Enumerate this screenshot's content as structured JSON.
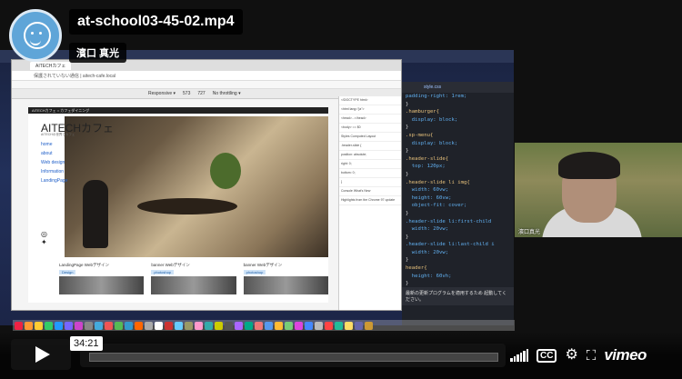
{
  "overlay": {
    "video_title": "at-school03-45-02.mp4",
    "byline": "濱口 真光"
  },
  "screen": {
    "browser": {
      "tab_title": "AITECHカフェ",
      "address": "保護されていない通信 | aitech-cafe.local",
      "devbar_device": "Responsive ▾",
      "devbar_w": "573",
      "devbar_h": "727",
      "devbar_throttle": "No throttling ▾",
      "site": {
        "topbar": "AITECHカフェ  ○  カフェダイニング",
        "brand": "AITECHカフェ",
        "brand_sub": "AITECHの世界でカフェ",
        "nav": [
          "home",
          "about",
          "Web design",
          "Information",
          "LandingPage"
        ],
        "works": [
          {
            "title": "LandingPage Webデザイン",
            "tag": "Design"
          },
          {
            "title": "banner Webデザイン",
            "tag": "photoshop"
          },
          {
            "title": "banner Webデザイン",
            "tag": "photoshop"
          }
        ]
      },
      "devtools_lines": [
        "<!DOCTYPE html>",
        "<html lang=\"ja\">",
        "<head>...</head>",
        "<body> == $0",
        "Styles  Computed  Layout",
        ".header-slide {",
        "position: absolute;",
        "right: 0;",
        "bottom: 0;",
        "}",
        "Console  What's New",
        "Highlights from the Chrome 97 update"
      ]
    },
    "editor": {
      "tab": "style.css",
      "lines": [
        {
          "n": "",
          "t": "padding-right: 1rem;"
        },
        {
          "n": "",
          "t": "}"
        },
        {
          "n": "",
          "t": ".hamburger{"
        },
        {
          "n": "",
          "t": "  display: block;"
        },
        {
          "n": "",
          "t": "}"
        },
        {
          "n": "",
          "t": ".sp-menu{"
        },
        {
          "n": "",
          "t": "  display: block;"
        },
        {
          "n": "",
          "t": "}"
        },
        {
          "n": "",
          "t": ".header-slide{"
        },
        {
          "n": "",
          "t": "  top: 120px;"
        },
        {
          "n": "",
          "t": "}"
        },
        {
          "n": "",
          "t": ".header-slide li img{"
        },
        {
          "n": "",
          "t": "  width: 60vw;"
        },
        {
          "n": "",
          "t": "  height: 60vw;"
        },
        {
          "n": "",
          "t": "  object-fit: cover;"
        },
        {
          "n": "",
          "t": "}"
        },
        {
          "n": "",
          "t": ".header-slide li:first-child"
        },
        {
          "n": "",
          "t": "  width: 20vw;"
        },
        {
          "n": "",
          "t": "}"
        },
        {
          "n": "",
          "t": ".header-slide li:last-child i"
        },
        {
          "n": "",
          "t": "  width: 20vw;"
        },
        {
          "n": "",
          "t": "}"
        },
        {
          "n": "",
          "t": "header{"
        },
        {
          "n": "",
          "t": "  height: 60vh;"
        },
        {
          "n": "",
          "t": "}"
        },
        {
          "n": "",
          "t": "nav{"
        },
        {
          "n": "",
          "t": "  width: 100%;"
        }
      ],
      "notification": "最新の更新プログラムを適用するため 起動してください。"
    }
  },
  "webcam": {
    "label": "濱口真光"
  },
  "controls": {
    "current_time": "34:21",
    "progress_fraction": 0.0,
    "cc_label": "CC",
    "brand": "vimeo"
  }
}
